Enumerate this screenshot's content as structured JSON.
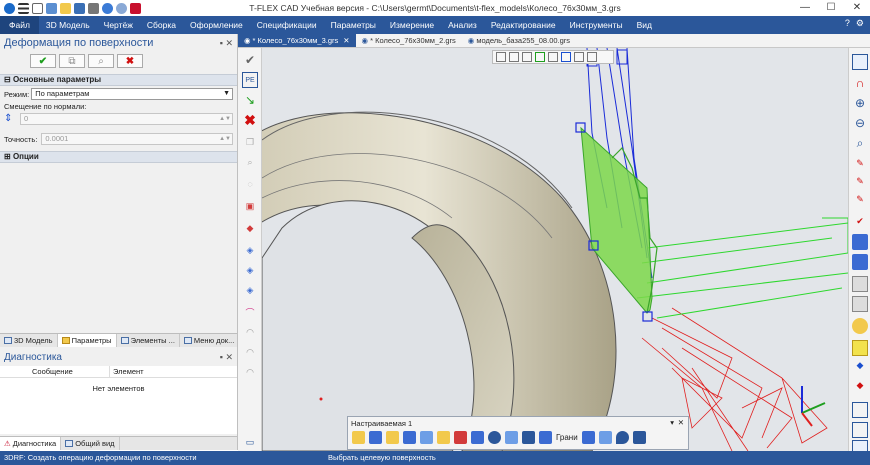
{
  "window": {
    "title": "T-FLEX CAD Учебная версия - C:\\Users\\germt\\Documents\\t-flex_models\\Колесо_76х30мм_3.grs",
    "controls": [
      "—",
      "☐",
      "✕"
    ]
  },
  "menu": {
    "items": [
      "Файл",
      "3D Модель",
      "Чертёж",
      "Сборка",
      "Оформление",
      "Спецификации",
      "Параметры",
      "Измерение",
      "Анализ",
      "Редактирование",
      "Инструменты",
      "Вид"
    ],
    "right": [
      "?",
      "⚙"
    ]
  },
  "left_panel": {
    "title": "Деформация по поверхности",
    "pin": "▪ ✕",
    "section_main": "Основные параметры",
    "mode_label": "Режим:",
    "mode_value": "По параметрам",
    "offset_label": "Смещение по нормали:",
    "offset_value": "0",
    "accuracy_label": "Точность:",
    "accuracy_value": "0.0001",
    "section_options": "Опции"
  },
  "left_tabs": [
    "3D Модель",
    "Параметры",
    "Элементы ...",
    "Меню док..."
  ],
  "diagnostics": {
    "title": "Диагностика",
    "pin": "▪ ✕",
    "col_message": "Сообщение",
    "col_element": "Элемент",
    "empty_text": "Нет элементов"
  },
  "bottom_tabs": [
    "Диагностика",
    "Общий вид"
  ],
  "doc_tabs": [
    "* Колесо_76х30мм_3.grs",
    "* Колесо_76х30мм_2.grs",
    "модель_база255_08.00.grs"
  ],
  "float_toolbar": {
    "title": "Настраиваемая 1",
    "faces_label": "Грани"
  },
  "status": {
    "left": "3DRF: Создать операцию деформации по поверхности",
    "center": "Выбрать целевую поверхность"
  },
  "colors": {
    "accent": "#2b579a",
    "selection_green": "#7dd84a",
    "wire_blue": "#1a2bd8",
    "wire_red": "#e02020"
  }
}
